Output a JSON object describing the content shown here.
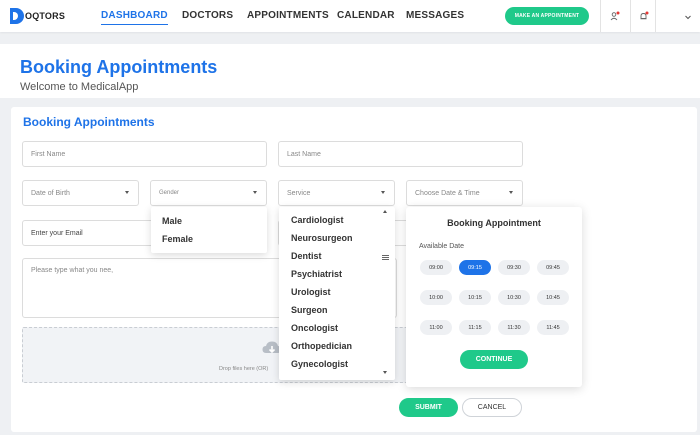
{
  "brand": {
    "logo_letter": "D",
    "name": "OQTORS"
  },
  "nav": {
    "links": [
      "DASHBOARD",
      "DOCTORS",
      "APPOINTMENTS",
      "CALENDAR",
      "MESSAGES"
    ],
    "active": "DASHBOARD",
    "cta": "MAKE AN APPOINTMENT",
    "icons": [
      "user-alert-icon",
      "bell-alert-icon",
      "chevron-down-icon"
    ]
  },
  "header": {
    "title": "Booking Appointments",
    "subtitle": "Welcome to MedicalApp"
  },
  "form": {
    "title": "Booking Appointments",
    "first_name_placeholder": "First Name",
    "last_name_placeholder": "Last Name",
    "dob_placeholder": "Date of Birth",
    "gender_placeholder": "Gender",
    "service_placeholder": "Service",
    "date_time_placeholder": "Choose Date & Time",
    "email_placeholder": "Enter your Email",
    "message_placeholder": "Please type what you nee,",
    "drop_text": "Drop files here (OR)",
    "submit_label": "SUBMIT",
    "cancel_label": "CANCEL"
  },
  "gender_options": [
    "Male",
    "Female"
  ],
  "service_options": [
    "Cardiologist",
    "Neurosurgeon",
    "Dentist",
    "Psychiatrist",
    "Urologist",
    "Surgeon",
    "Oncologist",
    "Orthopedician",
    "Gynecologist"
  ],
  "booking_panel": {
    "title": "Booking Appointment",
    "available_label": "Available Date",
    "slots": [
      "09:00",
      "09:15",
      "09:30",
      "09:45",
      "10:00",
      "10:15",
      "10:30",
      "10:45",
      "11:00",
      "11:15",
      "11:30",
      "11:45"
    ],
    "selected": "09:15",
    "continue_label": "CONTINUE"
  },
  "colors": {
    "primary": "#1e73e8",
    "accent": "#1fc98a",
    "alert": "#e53935"
  }
}
